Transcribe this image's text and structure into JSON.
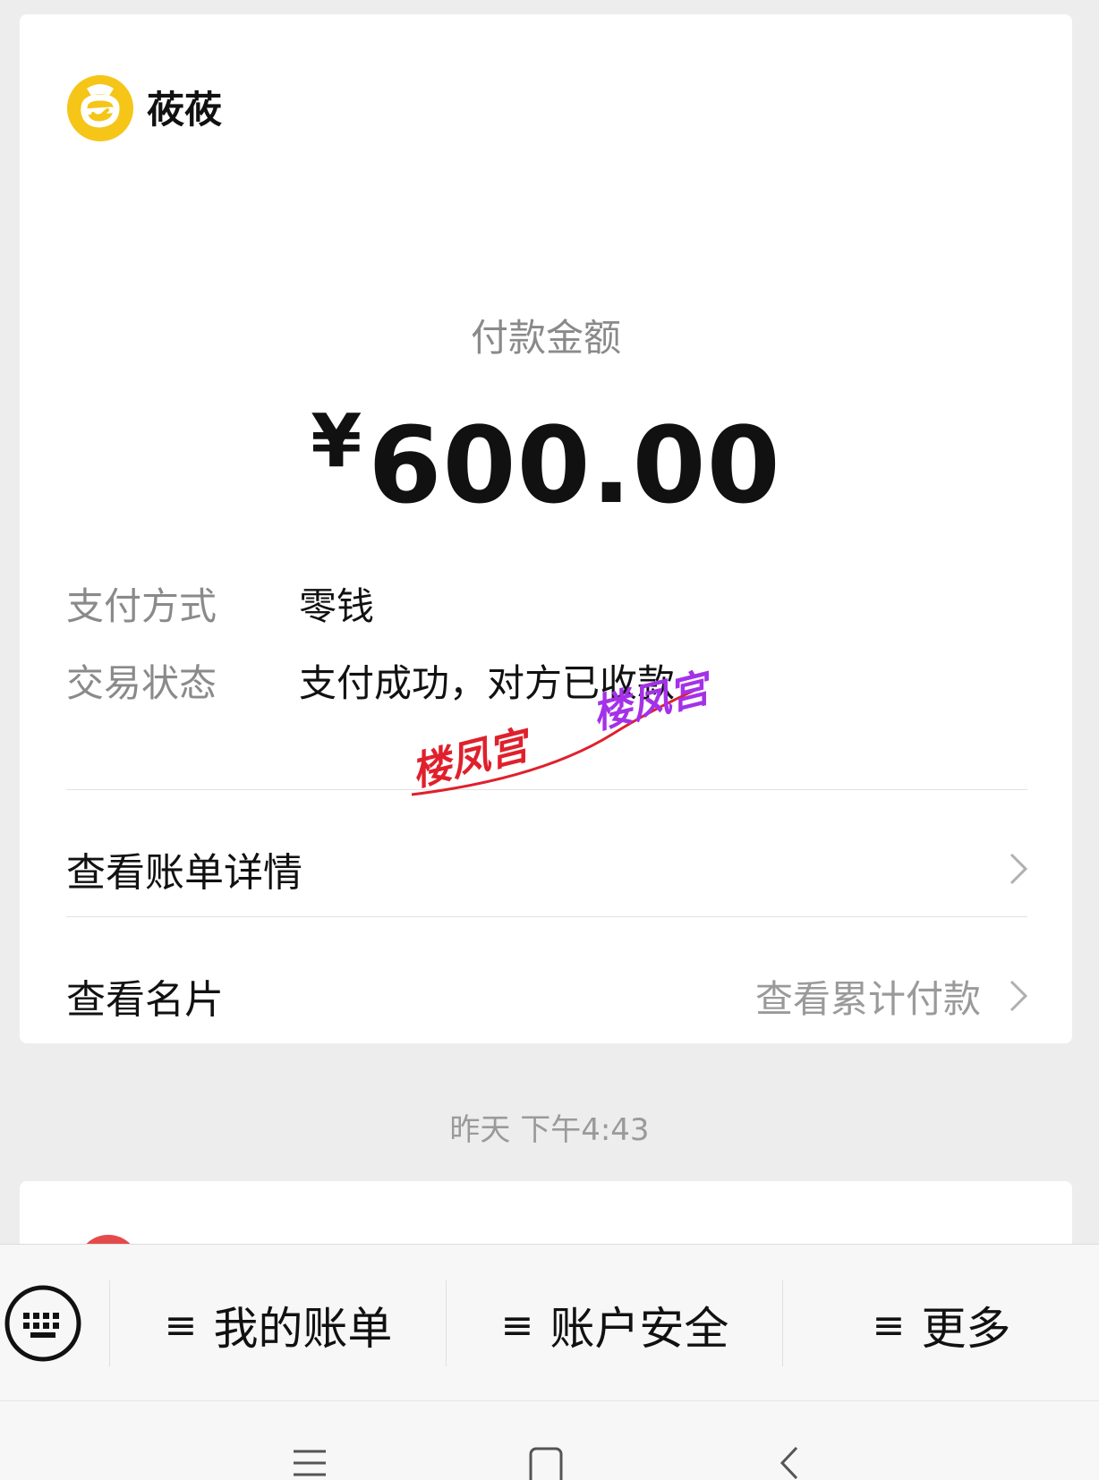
{
  "merchant": {
    "name": "莜莜",
    "logo_icon": "yellow-bag-logo"
  },
  "payment": {
    "amount_label": "付款金额",
    "currency_symbol": "¥",
    "amount": "600.00",
    "method_label": "支付方式",
    "method_value": "零钱",
    "status_label": "交易状态",
    "status_value": "支付成功，对方已收款"
  },
  "links": {
    "bill_details": "查看账单详情",
    "business_card": "查看名片",
    "cumulative_payment": "查看累计付款"
  },
  "watermark": {
    "text": "楼凤宫",
    "colors": [
      "#e0202c",
      "#a431e8"
    ]
  },
  "timestamp": "昨天 下午4:43",
  "menu": {
    "items": [
      {
        "label": "我的账单"
      },
      {
        "label": "账户安全"
      },
      {
        "label": "更多"
      }
    ]
  },
  "colors": {
    "background": "#ededed",
    "card": "#ffffff",
    "logo_yellow": "#f5c518"
  }
}
